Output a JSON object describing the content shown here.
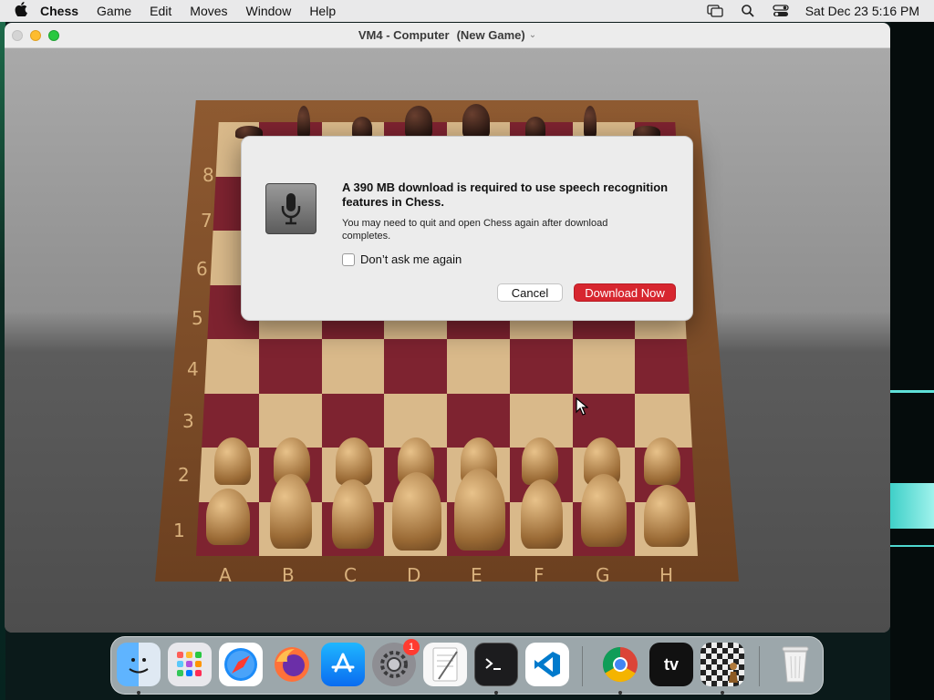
{
  "menubar": {
    "app": "Chess",
    "items": [
      "Game",
      "Edit",
      "Moves",
      "Window",
      "Help"
    ],
    "datetime": "Sat Dec 23  5:16 PM"
  },
  "window": {
    "title": "VM4 - Computer",
    "subtitle": "(New Game)"
  },
  "board": {
    "ranks": [
      "8",
      "7",
      "6",
      "5",
      "4",
      "3",
      "2",
      "1"
    ],
    "files": [
      "A",
      "B",
      "C",
      "D",
      "E",
      "F",
      "G",
      "H"
    ]
  },
  "dialog": {
    "title": "A 390 MB download is required to use speech recognition features in Chess.",
    "message": "You may need to quit and open Chess again after download completes.",
    "checkbox_label": "Don’t ask me again",
    "cancel_label": "Cancel",
    "primary_label": "Download Now"
  },
  "dock": {
    "system_settings_badge": "1",
    "apple_tv_label": "tv"
  },
  "colors": {
    "primary_button": "#d7262f",
    "dark_square": "#7e2330",
    "light_square": "#d9b98a"
  }
}
